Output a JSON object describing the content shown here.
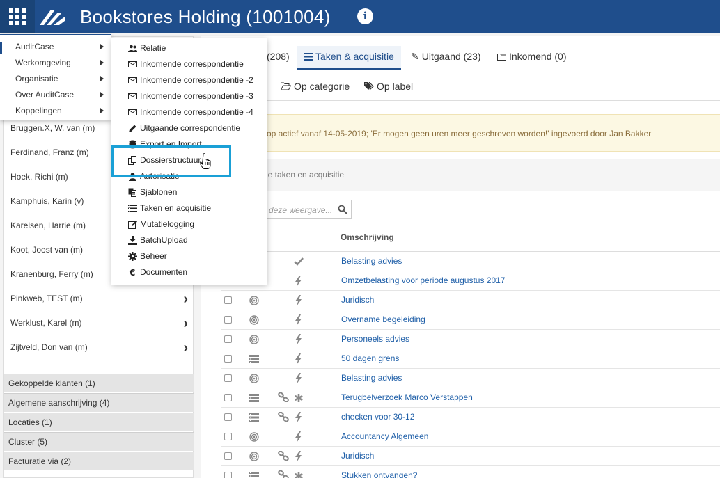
{
  "header": {
    "title": "Bookstores Holding (1001004)",
    "grid_icon": "apps-grid-icon",
    "logo": "auditcase-logo",
    "info_icon": "i"
  },
  "main_menu": {
    "items": [
      {
        "label": "AuditCase"
      },
      {
        "label": "Werkomgeving"
      },
      {
        "label": "Organisatie"
      },
      {
        "label": "Over AuditCase"
      },
      {
        "label": "Koppelingen"
      }
    ]
  },
  "submenu": {
    "items": [
      {
        "label": "Relatie",
        "icon": "users-icon"
      },
      {
        "label": "Inkomende correspondentie",
        "icon": "envelope-icon"
      },
      {
        "label": "Inkomende correspondentie -2",
        "icon": "envelope-icon"
      },
      {
        "label": "Inkomende correspondentie -3",
        "icon": "envelope-icon"
      },
      {
        "label": "Inkomende correspondentie -4",
        "icon": "envelope-icon"
      },
      {
        "label": "Uitgaande correspondentie",
        "icon": "pencil-icon"
      },
      {
        "label": "Export en Import",
        "icon": "database-icon"
      },
      {
        "label": "Dossierstructuur",
        "icon": "copy-icon"
      },
      {
        "label": "Autorisatie",
        "icon": "user-icon"
      },
      {
        "label": "Sjablonen",
        "icon": "files-icon"
      },
      {
        "label": "Taken en acquisitie",
        "icon": "tasks-icon"
      },
      {
        "label": "Mutatielogging",
        "icon": "edit-icon"
      },
      {
        "label": "BatchUpload",
        "icon": "download-icon"
      },
      {
        "label": "Beheer",
        "icon": "gear-icon"
      },
      {
        "label": "Documenten",
        "icon": "euro-icon"
      }
    ]
  },
  "employees": [
    {
      "name": "Bruggen.X, W. van (m)",
      "chevron": false
    },
    {
      "name": "Ferdinand, Franz (m)",
      "chevron": false
    },
    {
      "name": "Hoek, Richi (m)",
      "chevron": false
    },
    {
      "name": "Kamphuis, Karin (v)",
      "chevron": false
    },
    {
      "name": "Karelsen, Harrie (m)",
      "chevron": false
    },
    {
      "name": "Koot, Joost van (m)",
      "chevron": false
    },
    {
      "name": "Kranenburg, Ferry (m)",
      "chevron": false
    },
    {
      "name": "Pinkweb, TEST (m)",
      "chevron": true
    },
    {
      "name": "Werklust, Karel (m)",
      "chevron": true
    },
    {
      "name": "Zijtveld, Don van (m)",
      "chevron": true
    }
  ],
  "sections": [
    {
      "label": "Gekoppelde klanten (1)"
    },
    {
      "label": "Algemene aanschrijving (4)"
    },
    {
      "label": "Locaties (1)"
    },
    {
      "label": "Cluster (5)"
    },
    {
      "label": "Facturatie via (2)"
    }
  ],
  "tabs": {
    "partial_count": "(208)",
    "active": "Taken & acquisitie",
    "outgoing": "Uitgaand (23)",
    "incoming": "Inkomend (0)"
  },
  "subtabs": {
    "category": "Op categorie",
    "label": "Op label"
  },
  "warning": "op actief vanaf 14-05-2019; 'Er mogen geen uren meer geschreven worden!' ingevoerd door Jan Bakker",
  "subtitle": "le taken en acquisitie",
  "search": {
    "placeholder": "deze weergave..."
  },
  "table": {
    "column_description": "Omschrijving",
    "rows": [
      {
        "desc": "Belasting advies",
        "type": "",
        "link": false,
        "status": "check"
      },
      {
        "desc": "Omzetbelasting voor periode augustus 2017",
        "type": "",
        "link": false,
        "status": "bolt"
      },
      {
        "desc": "Juridisch",
        "type": "target",
        "link": false,
        "status": "bolt"
      },
      {
        "desc": "Overname begeleiding",
        "type": "target",
        "link": false,
        "status": "bolt"
      },
      {
        "desc": "Personeels advies",
        "type": "target",
        "link": false,
        "status": "bolt"
      },
      {
        "desc": "50 dagen grens",
        "type": "list",
        "link": false,
        "status": "bolt"
      },
      {
        "desc": "Belasting advies",
        "type": "target",
        "link": false,
        "status": "bolt"
      },
      {
        "desc": "Terugbelverzoek Marco Verstappen",
        "type": "list",
        "link": true,
        "status": "asterisk"
      },
      {
        "desc": "checken voor 30-12",
        "type": "list",
        "link": true,
        "status": "bolt"
      },
      {
        "desc": "Accountancy Algemeen",
        "type": "target",
        "link": false,
        "status": "bolt"
      },
      {
        "desc": "Juridisch",
        "type": "target",
        "link": true,
        "status": "bolt"
      },
      {
        "desc": "Stukken ontvangen?",
        "type": "list",
        "link": true,
        "status": "asterisk"
      }
    ]
  },
  "colors": {
    "header_bg": "#1f4e8c",
    "link": "#1f5fa8",
    "highlight": "#1aa0d6",
    "warning_bg": "#fcf8e3"
  }
}
